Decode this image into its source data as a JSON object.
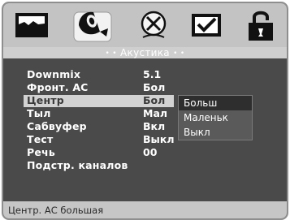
{
  "tabs": [
    {
      "icon": "picture-icon",
      "active": false
    },
    {
      "icon": "speaker-icon",
      "active": true
    },
    {
      "icon": "disc-icon",
      "active": false
    },
    {
      "icon": "checkbox-icon",
      "active": false
    },
    {
      "icon": "lock-icon",
      "active": false
    }
  ],
  "menu": {
    "title": "Акустика",
    "title_dots": "• •",
    "rows": [
      {
        "label": "Downmix",
        "value": "5.1"
      },
      {
        "label": "Фронт. АС",
        "value": "Бол"
      },
      {
        "label": "Центр",
        "value": "Бол"
      },
      {
        "label": "Тыл",
        "value": "Мал"
      },
      {
        "label": "Сабвуфер",
        "value": "Вкл"
      },
      {
        "label": "Тест",
        "value": "Выкл"
      },
      {
        "label": "Речь",
        "value": "00"
      },
      {
        "label": "Подстр. каналов",
        "value": ""
      }
    ],
    "selected_row": 2
  },
  "dropdown": {
    "options": [
      "Больш",
      "Маленьк",
      "Выкл"
    ],
    "selected": 0
  },
  "status": {
    "text": "Центр. АС большая"
  },
  "colors": {
    "background": "#4a4a4a",
    "tabbar": "#c3c3c3",
    "highlight": "#d2d2d2",
    "text": "#ffffff"
  }
}
